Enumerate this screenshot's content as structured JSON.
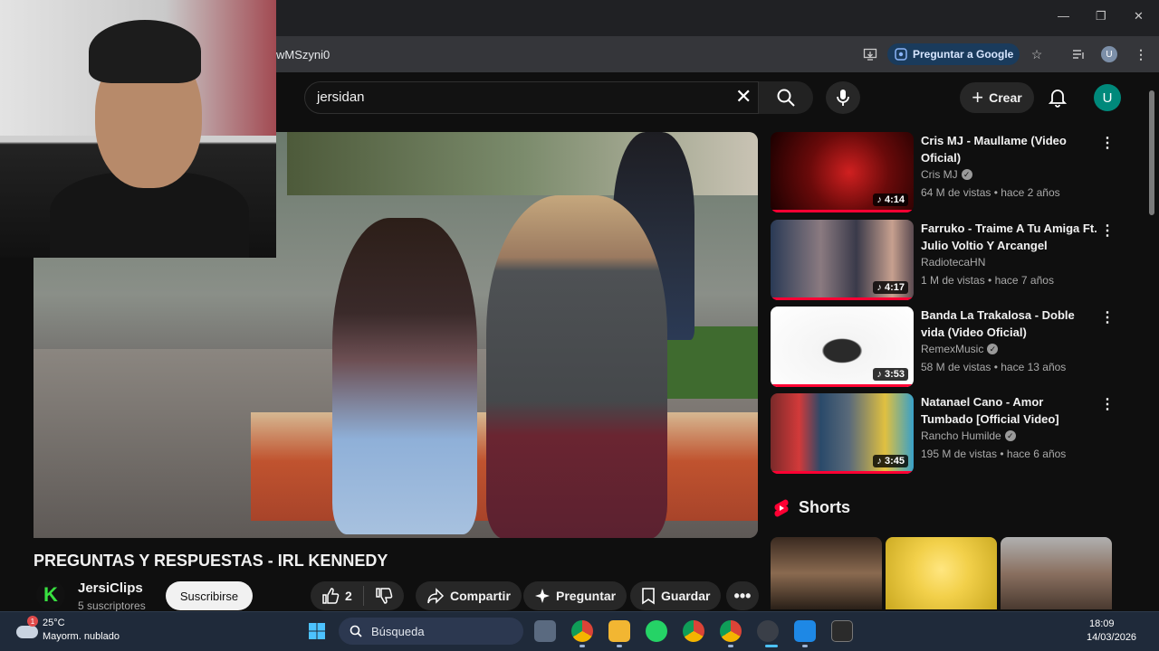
{
  "browser": {
    "url_fragment": "wMSzyni0",
    "ask_google_label": "Preguntar a Google",
    "profile_initial": "U"
  },
  "header": {
    "search_value": "jersidan",
    "create_label": "Crear",
    "avatar_initial": "U"
  },
  "video": {
    "title": "PREGUNTAS Y RESPUESTAS - IRL KENNEDY",
    "channel": "JersiClips",
    "channel_logo_letter": "K",
    "subscribers": "5 suscriptores",
    "subscribe_label": "Suscribirse",
    "likes": "2",
    "share_label": "Compartir",
    "ask_label": "Preguntar",
    "save_label": "Guardar"
  },
  "recommendations": [
    {
      "title": "Cris MJ - Maullame (Video Oficial)",
      "channel": "Cris MJ",
      "verified": true,
      "meta": "64 M de vistas • hace 2 años",
      "duration": "4:14"
    },
    {
      "title": "Farruko - Traime A Tu Amiga Ft. Julio Voltio Y Arcangel",
      "channel": "RadiotecaHN",
      "verified": false,
      "meta": "1 M de vistas • hace 7 años",
      "duration": "4:17"
    },
    {
      "title": "Banda La Trakalosa - Doble vida (Video Oficial)",
      "channel": "RemexMusic",
      "verified": true,
      "meta": "58 M de vistas • hace 13 años",
      "duration": "3:53"
    },
    {
      "title": "Natanael Cano - Amor Tumbado [Official Video]",
      "channel": "Rancho Humilde",
      "verified": true,
      "meta": "195 M de vistas • hace 6 años",
      "duration": "3:45"
    }
  ],
  "shorts": {
    "heading": "Shorts"
  },
  "taskbar": {
    "temperature": "25°C",
    "weather": "Mayorm. nublado",
    "weather_badge": "1",
    "search_placeholder": "Búsqueda",
    "time": "18:09",
    "date": "14/03/2026"
  },
  "colors": {
    "accent_red": "#ff0033",
    "avatar_teal": "#00897b",
    "background": "#0f0f0f"
  }
}
